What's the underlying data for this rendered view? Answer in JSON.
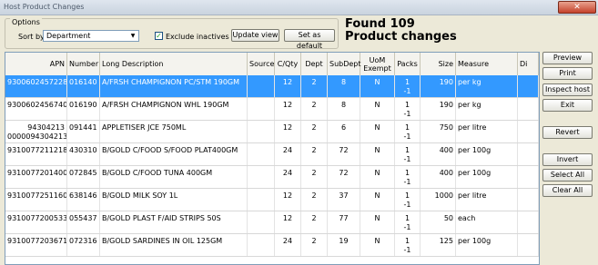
{
  "window": {
    "title": "Host Product Changes",
    "close_glyph": "✕"
  },
  "options": {
    "legend": "Options",
    "sort_label": "Sort by",
    "sort_value": "Department",
    "exclude_label": "Exclude inactives",
    "exclude_checked": true,
    "update_view": "Update view",
    "set_default": "Set as default"
  },
  "summary": {
    "line1": "Found 109",
    "line2": "Product changes"
  },
  "columns": [
    "APN",
    "Number",
    "Long Description",
    "Source",
    "C/Qty",
    "Dept",
    "SubDept",
    "UoM Exempt",
    "Packs",
    "Size",
    "Measure",
    "Di"
  ],
  "rows": [
    {
      "apn": "9300602457228",
      "apn2": "",
      "number": "016140",
      "desc": "A/FRSH CHAMPIGNON PC/STM 190GM",
      "source": "",
      "cqty": "12",
      "dept": "2",
      "subdept": "8",
      "uom": "N",
      "packs": "1",
      "packs2": "-1",
      "size": "190",
      "measure": "per kg",
      "selected": true
    },
    {
      "apn": "9300602456740",
      "apn2": "",
      "number": "016190",
      "desc": "A/FRSH CHAMPIGNON WHL    190GM",
      "source": "",
      "cqty": "12",
      "dept": "2",
      "subdept": "8",
      "uom": "N",
      "packs": "1",
      "packs2": "-1",
      "size": "190",
      "measure": "per kg",
      "selected": false
    },
    {
      "apn": "94304213",
      "apn2": "0000094304213",
      "number": "091441",
      "desc": "APPLETISER JCE          750ML",
      "source": "",
      "cqty": "12",
      "dept": "2",
      "subdept": "6",
      "uom": "N",
      "packs": "1",
      "packs2": "-1",
      "size": "750",
      "measure": "per litre",
      "selected": false
    },
    {
      "apn": "9310077211218",
      "apn2": "",
      "number": "430310",
      "desc": "B/GOLD C/FOOD S/FOOD PLAT400GM",
      "source": "",
      "cqty": "24",
      "dept": "2",
      "subdept": "72",
      "uom": "N",
      "packs": "1",
      "packs2": "-1",
      "size": "400",
      "measure": "per 100g",
      "selected": false
    },
    {
      "apn": "9310077201400",
      "apn2": "",
      "number": "072845",
      "desc": "B/GOLD C/FOOD TUNA       400GM",
      "source": "",
      "cqty": "24",
      "dept": "2",
      "subdept": "72",
      "uom": "N",
      "packs": "1",
      "packs2": "-1",
      "size": "400",
      "measure": "per 100g",
      "selected": false
    },
    {
      "apn": "9310077251160",
      "apn2": "",
      "number": "638146",
      "desc": "B/GOLD MILK SOY          1L",
      "source": "",
      "cqty": "12",
      "dept": "2",
      "subdept": "37",
      "uom": "N",
      "packs": "1",
      "packs2": "-1",
      "size": "1000",
      "measure": "per litre",
      "selected": false
    },
    {
      "apn": "9310077200533",
      "apn2": "",
      "number": "055437",
      "desc": "B/GOLD PLAST F/AID STRIPS  50S",
      "source": "",
      "cqty": "12",
      "dept": "2",
      "subdept": "77",
      "uom": "N",
      "packs": "1",
      "packs2": "-1",
      "size": "50",
      "measure": "each",
      "selected": false
    },
    {
      "apn": "9310077203671",
      "apn2": "",
      "number": "072316",
      "desc": "B/GOLD SARDINES IN OIL   125GM",
      "source": "",
      "cqty": "24",
      "dept": "2",
      "subdept": "19",
      "uom": "N",
      "packs": "1",
      "packs2": "-1",
      "size": "125",
      "measure": "per 100g",
      "selected": false
    }
  ],
  "side_buttons": [
    "Preview",
    "Print",
    "Inspect host",
    "Exit",
    "Revert",
    "Invert",
    "Select All",
    "Clear All"
  ]
}
